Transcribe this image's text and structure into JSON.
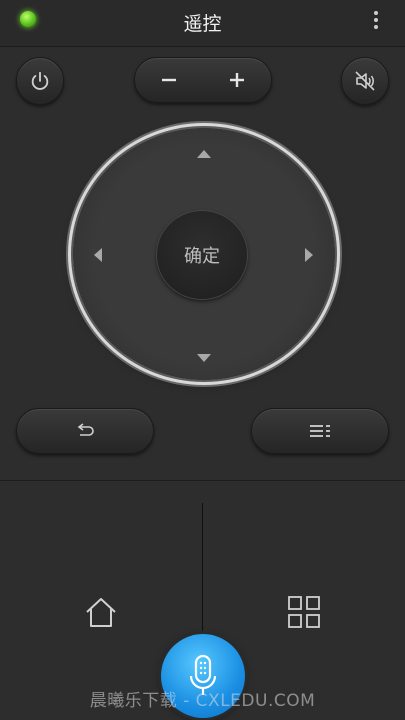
{
  "header": {
    "title": "遥控"
  },
  "dpad": {
    "ok_label": "确定"
  },
  "watermark": "晨曦乐下载 - CXLEDU.COM",
  "colors": {
    "status_led": "#5cc21c",
    "mic_accent": "#1a8fe2",
    "background": "#2d2d2d"
  },
  "icons": {
    "status": "green-led-icon",
    "more": "more-vertical-icon",
    "power": "power-icon",
    "volume_down": "minus-icon",
    "volume_up": "plus-icon",
    "mute": "mute-icon",
    "up": "arrow-up-icon",
    "down": "arrow-down-icon",
    "left": "arrow-left-icon",
    "right": "arrow-right-icon",
    "back": "back-icon",
    "menu": "menu-icon",
    "home": "home-icon",
    "apps": "apps-grid-icon",
    "mic": "microphone-icon"
  }
}
